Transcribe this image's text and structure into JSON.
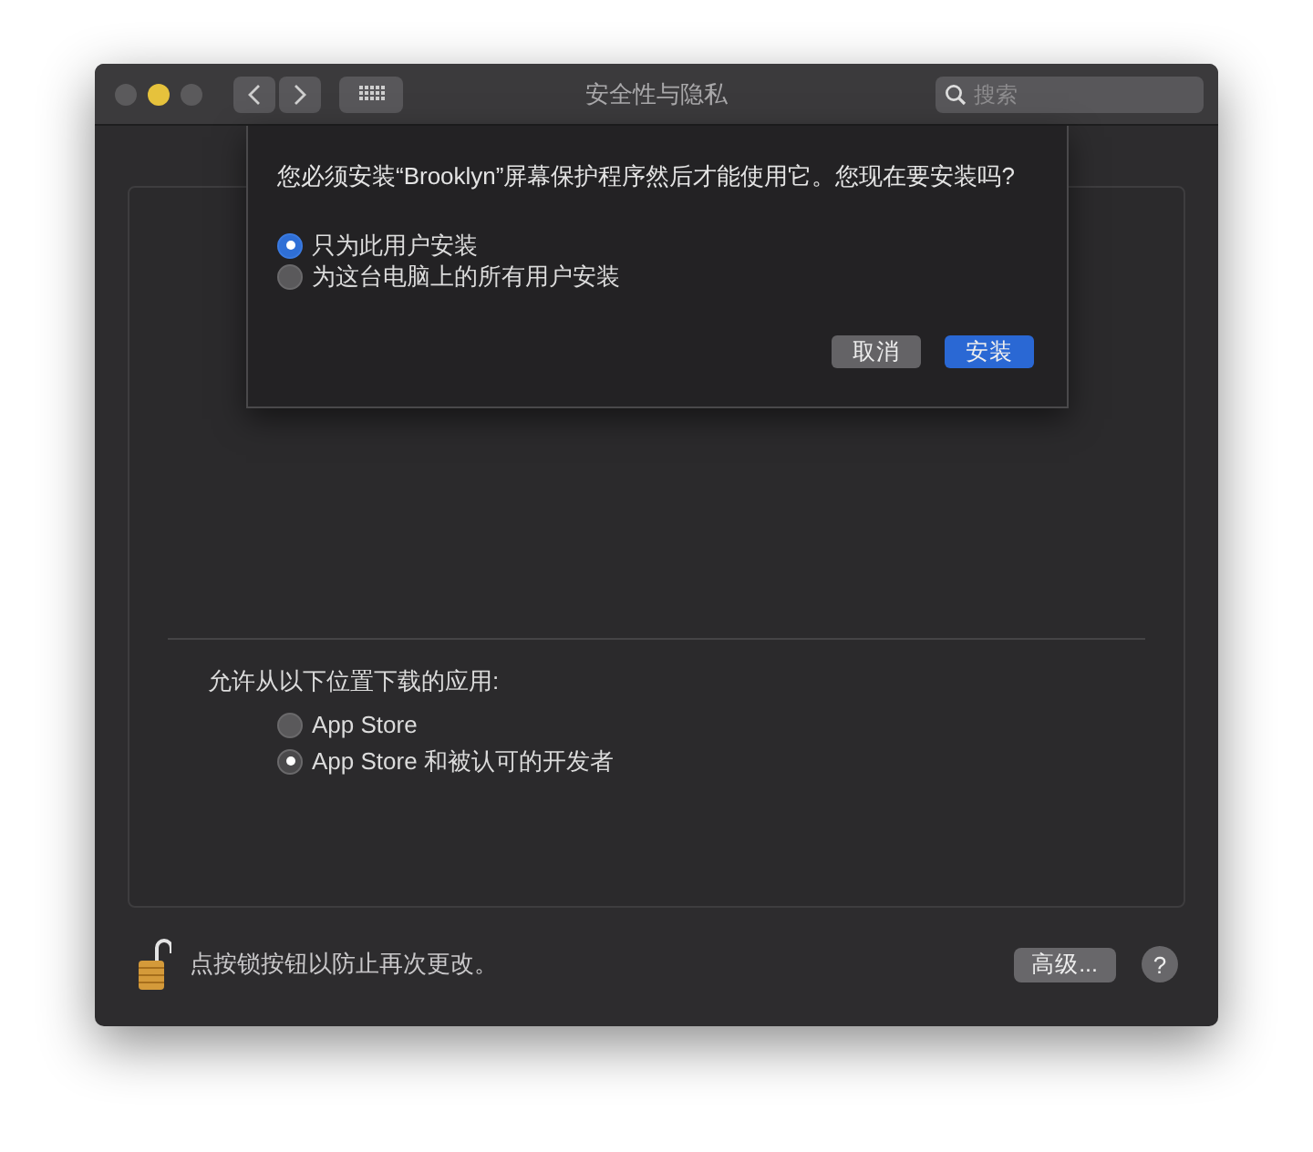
{
  "window": {
    "title": "安全性与隐私",
    "search": {
      "placeholder": "搜索"
    }
  },
  "sheet": {
    "message": "您必须安装“Brooklyn”屏幕保护程序然后才能使用它。您现在要安装吗?",
    "options": [
      {
        "label": "只为此用户安装",
        "selected": true
      },
      {
        "label": "为这台电脑上的所有用户安装",
        "selected": false
      }
    ],
    "buttons": [
      {
        "label": "取消",
        "kind": "secondary"
      },
      {
        "label": "安装",
        "kind": "default"
      }
    ]
  },
  "downloads": {
    "heading": "允许从以下位置下载的应用:",
    "options": [
      {
        "label": "App Store",
        "selected": false
      },
      {
        "label": "App Store 和被认可的开发者",
        "selected": true
      }
    ]
  },
  "footer": {
    "lock_text": "点按锁按钮以防止再次更改。",
    "advanced_button": "高级...",
    "help_button": "?"
  }
}
